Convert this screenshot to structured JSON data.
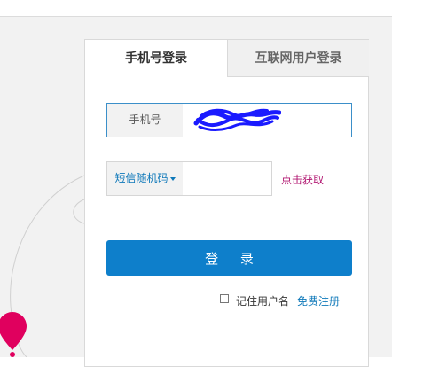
{
  "tabs": {
    "phone_login": "手机号登录",
    "internet_login": "互联网用户登录"
  },
  "phone": {
    "prefix_label": "手机号",
    "value": ""
  },
  "sms": {
    "type_label": "短信随机码",
    "code_value": "",
    "get_code_label": "点击获取"
  },
  "login_button": "登 录",
  "remember": {
    "label": "记住用户名",
    "checked": false
  },
  "register_link": "免费注册",
  "colors": {
    "accent": "#0e7fcb",
    "link": "#0e78b9",
    "get_code": "#b0136f",
    "map_pin": "#e0005e",
    "scribble": "#1a1aff"
  }
}
